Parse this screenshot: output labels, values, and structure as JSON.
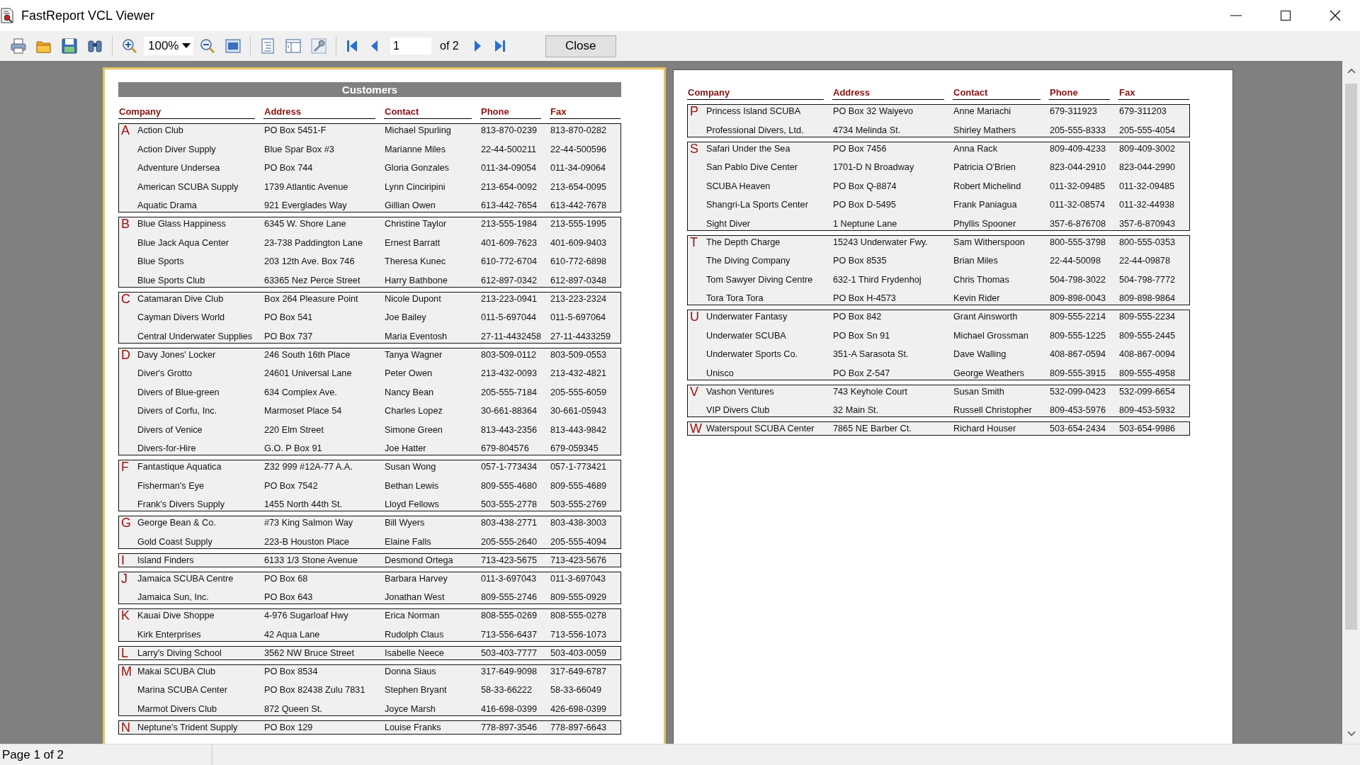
{
  "window": {
    "title": "FastReport VCL Viewer"
  },
  "toolbar": {
    "zoom": "100%",
    "page_number": "1",
    "page_total": "of 2",
    "close": "Close"
  },
  "pages": [
    {
      "selected": true,
      "title": "Customers",
      "columns": [
        "Company",
        "Address",
        "Contact",
        "Phone",
        "Fax"
      ],
      "groups": [
        {
          "letter": "A",
          "rows": [
            [
              "Action Club",
              "PO Box 5451-F",
              "Michael Spurling",
              "813-870-0239",
              "813-870-0282"
            ],
            [
              "Action Diver Supply",
              "Blue Spar Box #3",
              "Marianne Miles",
              "22-44-500211",
              "22-44-500596"
            ],
            [
              "Adventure Undersea",
              "PO Box 744",
              "Gloria Gonzales",
              "011-34-09054",
              "011-34-09064"
            ],
            [
              "American SCUBA Supply",
              "1739 Atlantic Avenue",
              "Lynn Cinciripini",
              "213-654-0092",
              "213-654-0095"
            ],
            [
              "Aquatic Drama",
              "921 Everglades Way",
              "Gillian Owen",
              "613-442-7654",
              "613-442-7678"
            ]
          ]
        },
        {
          "letter": "B",
          "rows": [
            [
              "Blue Glass Happiness",
              "6345 W. Shore Lane",
              "Christine Taylor",
              "213-555-1984",
              "213-555-1995"
            ],
            [
              "Blue Jack Aqua Center",
              "23-738 Paddington Lane",
              "Ernest Barratt",
              "401-609-7623",
              "401-609-9403"
            ],
            [
              "Blue Sports",
              "203 12th Ave. Box 746",
              "Theresa Kunec",
              "610-772-6704",
              "610-772-6898"
            ],
            [
              "Blue Sports Club",
              "63365 Nez Perce Street",
              "Harry Bathbone",
              "612-897-0342",
              "612-897-0348"
            ]
          ]
        },
        {
          "letter": "C",
          "rows": [
            [
              "Catamaran Dive Club",
              "Box 264 Pleasure Point",
              "Nicole Dupont",
              "213-223-0941",
              "213-223-2324"
            ],
            [
              "Cayman Divers World",
              "PO Box 541",
              "Joe Bailey",
              "011-5-697044",
              "011-5-697064"
            ],
            [
              "Central Underwater Supplies",
              "PO Box 737",
              "Maria Eventosh",
              "27-11-4432458",
              "27-11-4433259"
            ]
          ]
        },
        {
          "letter": "D",
          "rows": [
            [
              "Davy Jones' Locker",
              "246 South 16th Place",
              "Tanya Wagner",
              "803-509-0112",
              "803-509-0553"
            ],
            [
              "Diver's Grotto",
              "24601 Universal Lane",
              "Peter Owen",
              "213-432-0093",
              "213-432-4821"
            ],
            [
              "Divers of Blue-green",
              "634 Complex Ave.",
              "Nancy Bean",
              "205-555-7184",
              "205-555-6059"
            ],
            [
              "Divers of Corfu, Inc.",
              "Marmoset Place 54",
              "Charles Lopez",
              "30-661-88364",
              "30-661-05943"
            ],
            [
              "Divers of Venice",
              "220 Elm Street",
              "Simone Green",
              "813-443-2356",
              "813-443-9842"
            ],
            [
              "Divers-for-Hire",
              "G.O. P Box 91",
              "Joe Hatter",
              "679-804576",
              "679-059345"
            ]
          ]
        },
        {
          "letter": "F",
          "rows": [
            [
              "Fantastique Aquatica",
              "Z32 999 #12A-77 A.A.",
              "Susan Wong",
              "057-1-773434",
              "057-1-773421"
            ],
            [
              "Fisherman's Eye",
              "PO Box 7542",
              "Bethan Lewis",
              "809-555-4680",
              "809-555-4689"
            ],
            [
              "Frank's Divers Supply",
              "1455 North 44th St.",
              "Lloyd Fellows",
              "503-555-2778",
              "503-555-2769"
            ]
          ]
        },
        {
          "letter": "G",
          "rows": [
            [
              "George Bean & Co.",
              "#73 King Salmon Way",
              "Bill Wyers",
              "803-438-2771",
              "803-438-3003"
            ],
            [
              "Gold Coast Supply",
              "223-B Houston Place",
              "Elaine Falls",
              "205-555-2640",
              "205-555-4094"
            ]
          ]
        },
        {
          "letter": "I",
          "rows": [
            [
              "Island Finders",
              "6133 1/3 Stone Avenue",
              "Desmond Ortega",
              "713-423-5675",
              "713-423-5676"
            ]
          ]
        },
        {
          "letter": "J",
          "rows": [
            [
              "Jamaica SCUBA Centre",
              "PO Box 68",
              "Barbara Harvey",
              "011-3-697043",
              "011-3-697043"
            ],
            [
              "Jamaica Sun, Inc.",
              "PO Box 643",
              "Jonathan West",
              "809-555-2746",
              "809-555-0929"
            ]
          ]
        },
        {
          "letter": "K",
          "rows": [
            [
              "Kauai Dive Shoppe",
              "4-976 Sugarloaf Hwy",
              "Erica Norman",
              "808-555-0269",
              "808-555-0278"
            ],
            [
              "Kirk Enterprises",
              "42 Aqua Lane",
              "Rudolph Claus",
              "713-556-6437",
              "713-556-1073"
            ]
          ]
        },
        {
          "letter": "L",
          "rows": [
            [
              "Larry's Diving School",
              "3562 NW Bruce Street",
              "Isabelle Neece",
              "503-403-7777",
              "503-403-0059"
            ]
          ]
        },
        {
          "letter": "M",
          "rows": [
            [
              "Makai SCUBA Club",
              "PO Box 8534",
              "Donna Siaus",
              "317-649-9098",
              "317-649-6787"
            ],
            [
              "Marina SCUBA Center",
              "PO Box 82438 Zulu 7831",
              "Stephen Bryant",
              "58-33-66222",
              "58-33-66049"
            ],
            [
              "Marmot Divers Club",
              "872 Queen St.",
              "Joyce Marsh",
              "416-698-0399",
              "426-698-0399"
            ]
          ]
        },
        {
          "letter": "N",
          "rows": [
            [
              "Neptune's Trident Supply",
              "PO Box 129",
              "Louise Franks",
              "778-897-3546",
              "778-897-6643"
            ]
          ]
        }
      ]
    },
    {
      "selected": false,
      "columns": [
        "Company",
        "Address",
        "Contact",
        "Phone",
        "Fax"
      ],
      "groups": [
        {
          "letter": "P",
          "rows": [
            [
              "Princess Island SCUBA",
              "PO Box 32 Waiyevo",
              "Anne Mariachi",
              "679-311923",
              "679-311203"
            ],
            [
              "Professional Divers, Ltd.",
              "4734 Melinda St.",
              "Shirley Mathers",
              "205-555-8333",
              "205-555-4054"
            ]
          ]
        },
        {
          "letter": "S",
          "rows": [
            [
              "Safari Under the Sea",
              "PO Box 7456",
              "Anna Rack",
              "809-409-4233",
              "809-409-3002"
            ],
            [
              "San Pablo Dive Center",
              "1701-D N Broadway",
              "Patricia O'Brien",
              "823-044-2910",
              "823-044-2990"
            ],
            [
              "SCUBA Heaven",
              "PO Box Q-8874",
              "Robert Michelind",
              "011-32-09485",
              "011-32-09485"
            ],
            [
              "Shangri-La Sports Center",
              "PO Box D-5495",
              "Frank Paniagua",
              "011-32-08574",
              "011-32-44938"
            ],
            [
              "Sight Diver",
              "1 Neptune Lane",
              "Phyllis Spooner",
              "357-6-876708",
              "357-6-870943"
            ]
          ]
        },
        {
          "letter": "T",
          "rows": [
            [
              "The Depth Charge",
              "15243 Underwater Fwy.",
              "Sam Witherspoon",
              "800-555-3798",
              "800-555-0353"
            ],
            [
              "The Diving Company",
              "PO Box 8535",
              "Brian Miles",
              "22-44-50098",
              "22-44-09878"
            ],
            [
              "Tom Sawyer Diving Centre",
              "632-1 Third Frydenhoj",
              "Chris Thomas",
              "504-798-3022",
              "504-798-7772"
            ],
            [
              "Tora Tora Tora",
              "PO Box H-4573",
              "Kevin Rider",
              "809-898-0043",
              "809-898-9864"
            ]
          ]
        },
        {
          "letter": "U",
          "rows": [
            [
              "Underwater Fantasy",
              "PO Box 842",
              "Grant Ainsworth",
              "809-555-2214",
              "809-555-2234"
            ],
            [
              "Underwater SCUBA",
              "PO Box Sn 91",
              "Michael Grossman",
              "809-555-1225",
              "809-555-2445"
            ],
            [
              "Underwater Sports Co.",
              "351-A Sarasota St.",
              "Dave Walling",
              "408-867-0594",
              "408-867-0094"
            ],
            [
              "Unisco",
              "PO Box Z-547",
              "George Weathers",
              "809-555-3915",
              "809-555-4958"
            ]
          ]
        },
        {
          "letter": "V",
          "rows": [
            [
              "Vashon Ventures",
              "743 Keyhole Court",
              "Susan Smith",
              "532-099-0423",
              "532-099-6654"
            ],
            [
              "VIP Divers Club",
              "32 Main St.",
              "Russell Christopher",
              "809-453-5976",
              "809-453-5932"
            ]
          ]
        },
        {
          "letter": "W",
          "rows": [
            [
              "Waterspout SCUBA Center",
              "7865 NE Barber Ct.",
              "Richard Houser",
              "503-654-2434",
              "503-654-9986"
            ]
          ]
        }
      ]
    }
  ],
  "status_bar": {
    "text": "Page 1 of 2"
  }
}
